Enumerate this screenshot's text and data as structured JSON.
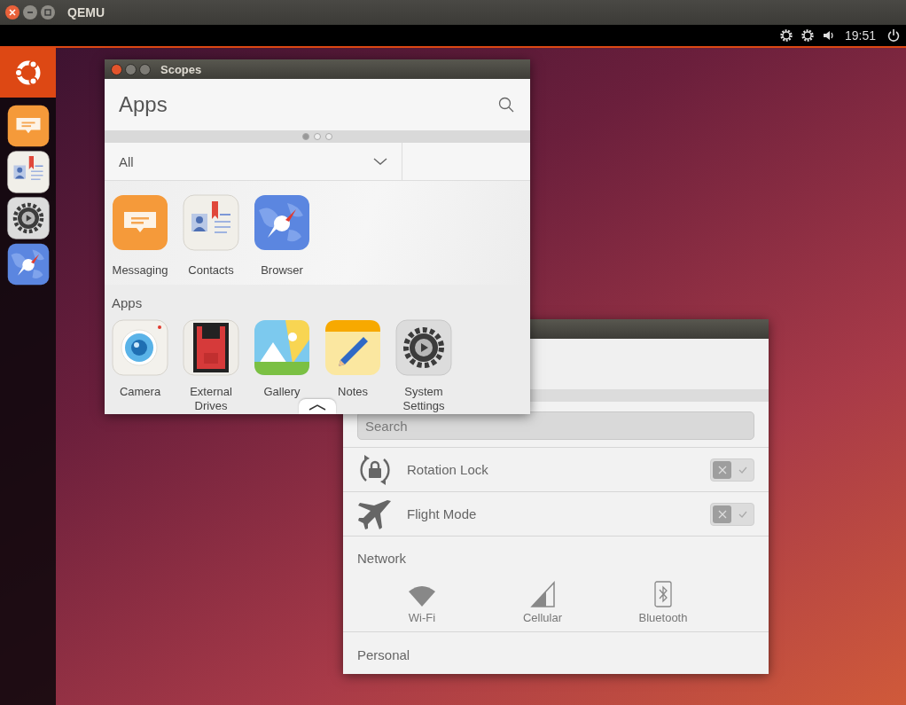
{
  "window": {
    "title": "QEMU"
  },
  "panel": {
    "time": "19:51"
  },
  "launcher": {
    "items": [
      {
        "kind": "messaging"
      },
      {
        "kind": "contacts"
      },
      {
        "kind": "settings"
      },
      {
        "kind": "browser"
      }
    ]
  },
  "scopes_window": {
    "title": "Scopes",
    "header": "Apps",
    "page_dots": [
      {
        "selected": true
      },
      {
        "selected": false
      },
      {
        "selected": false
      }
    ],
    "filter": "All",
    "featured": [
      {
        "label": "Messaging",
        "kind": "messaging"
      },
      {
        "label": "Contacts",
        "kind": "contacts"
      },
      {
        "label": "Browser",
        "kind": "browser"
      }
    ],
    "section": "Apps",
    "apps": [
      {
        "label": "Camera",
        "kind": "camera"
      },
      {
        "label": "External Drives",
        "kind": "drives"
      },
      {
        "label": "Gallery",
        "kind": "gallery"
      },
      {
        "label": "Notes",
        "kind": "notes"
      },
      {
        "label": "System Settings",
        "kind": "settings"
      }
    ]
  },
  "settings_window": {
    "search": {
      "placeholder": "Search"
    },
    "toggles": [
      {
        "label": "Rotation Lock",
        "kind": "rotation",
        "on": false
      },
      {
        "label": "Flight Mode",
        "kind": "flight",
        "on": false
      }
    ],
    "network": {
      "title": "Network",
      "items": [
        {
          "label": "Wi-Fi",
          "kind": "wifi"
        },
        {
          "label": "Cellular",
          "kind": "cellular"
        },
        {
          "label": "Bluetooth",
          "kind": "bluetooth"
        }
      ]
    },
    "personal": "Personal"
  }
}
